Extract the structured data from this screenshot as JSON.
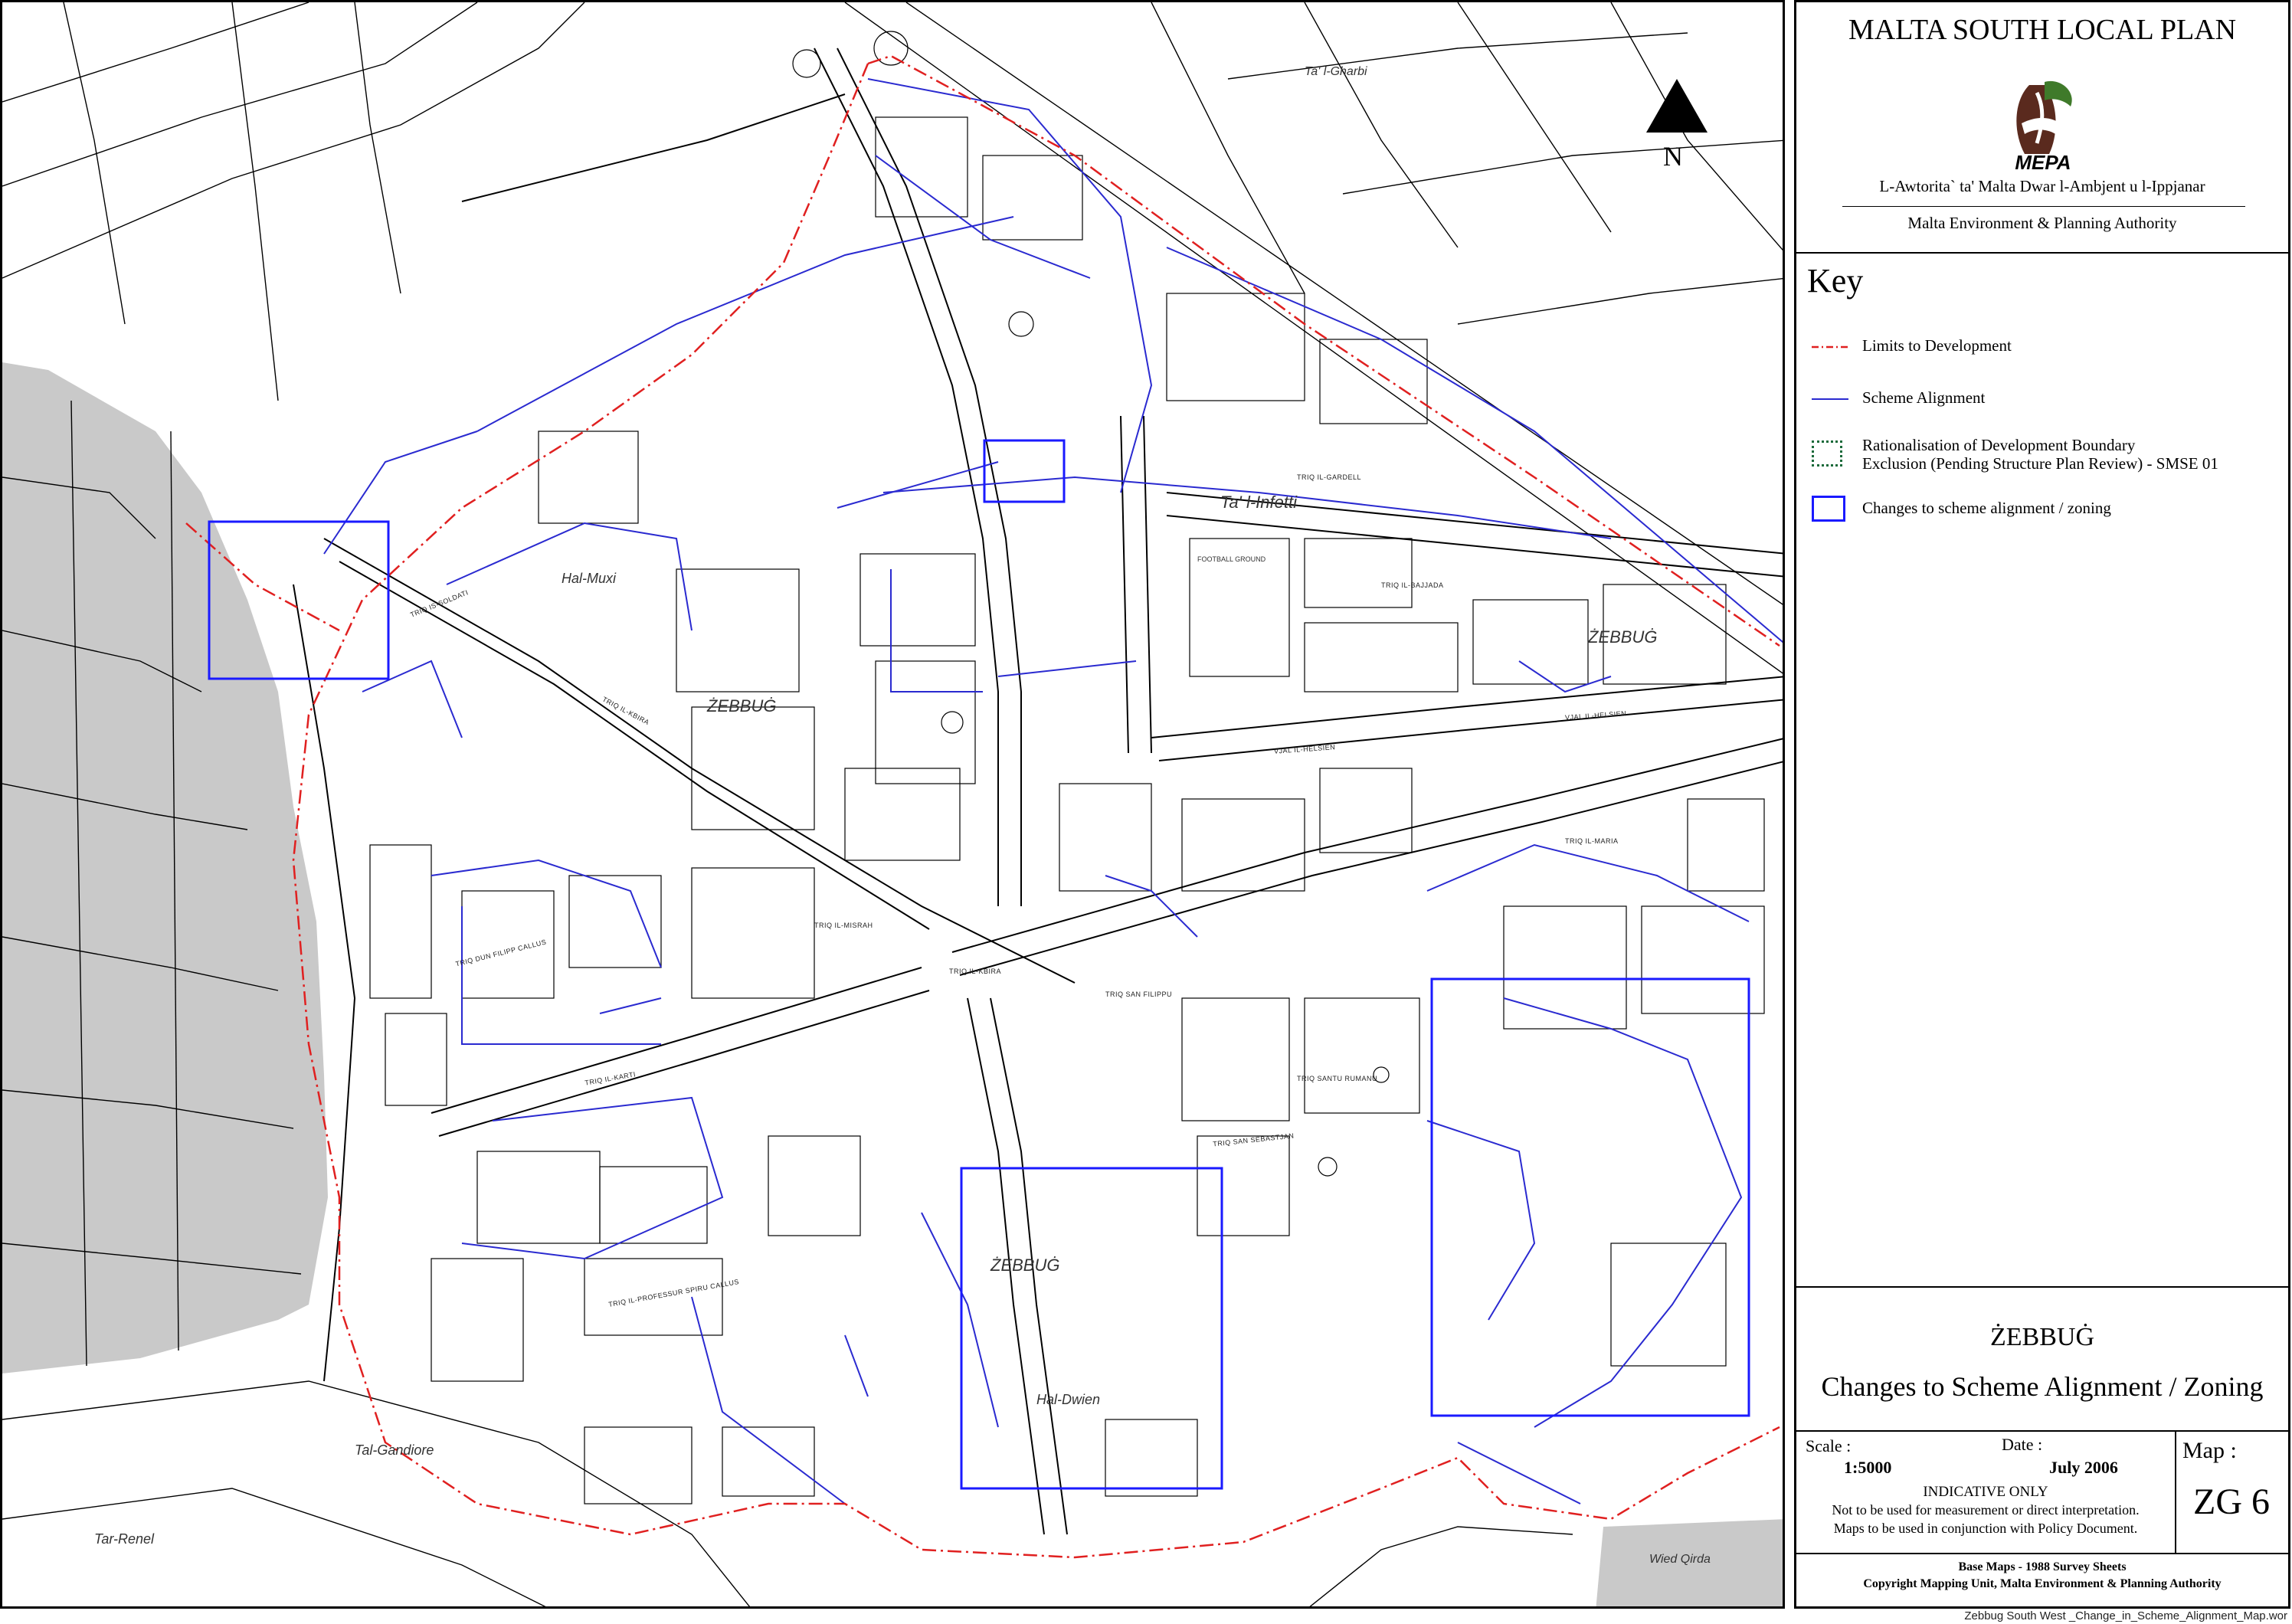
{
  "map": {
    "place_labels": [
      "Ta' l-Gharbi",
      "Ta' l-Infetti",
      "ŻEBBUĠ",
      "ŻEBBUĠ",
      "ŻEBBUĠ",
      "Hal-Muxi",
      "Hal-Dwien",
      "Tal-Gandiore",
      "Tar-Renel",
      "Wied Qirda",
      "FOOTBALL GROUND"
    ],
    "street_labels": [
      "TRIQ IL-KBIRA",
      "TRIQ IL-KBIRA",
      "VJAL IL-HELSIEN",
      "VJAL IL-HELSIEN",
      "TRIQ IL-MISRAH",
      "TRIQ IL-BAJJADA",
      "TRIQ SAN FILIPPU",
      "TRIQ IL-GARDELL",
      "TRIQ DUN FILIPP CALLUS",
      "TRIQ IS-SOLDATI",
      "TRIQ IL-PROFESSUR SPIRU CALLUS",
      "TRIQ SAN SEBASTJAN",
      "TRIQ IL-KARTI",
      "TRIQ IL-MARIA",
      "TRIQ SANTU RUMANU"
    ],
    "north_label": "N",
    "colors": {
      "limits": "#e02020",
      "scheme": "#2a2ad0",
      "changes": "#1a1aff",
      "rationalisation": "#1a6a3a",
      "grey_area": "#c9c9c9",
      "base": "#000000"
    }
  },
  "panel": {
    "title": "MALTA SOUTH LOCAL PLAN",
    "logo_text": "MEPA",
    "authority_mt": "L-Awtorita` ta' Malta Dwar l-Ambjent u l-Ippjanar",
    "authority_en": "Malta Environment & Planning Authority",
    "key_heading": "Key",
    "key_items": {
      "limits": "Limits to Development",
      "scheme": "Scheme Alignment",
      "rationalisation_1": "Rationalisation of Development Boundary",
      "rationalisation_2": "Exclusion (Pending Structure Plan Review) - SMSE 01",
      "changes": "Changes to scheme alignment / zoning"
    },
    "place": "ŻEBBUĠ",
    "map_title": "Changes to Scheme Alignment / Zoning",
    "scale_label": "Scale :",
    "scale_value": "1:5000",
    "date_label": "Date :",
    "date_value": "July 2006",
    "indicative": "INDICATIVE ONLY",
    "notice_1": "Not to be used for measurement or direct interpretation.",
    "notice_2": "Maps to be used in conjunction with Policy Document.",
    "map_label": "Map :",
    "map_number": "ZG 6",
    "base_maps": "Base Maps - 1988 Survey Sheets",
    "copyright": "Copyright Mapping Unit, Malta Environment & Planning Authority"
  },
  "footer": {
    "filename": "Zebbug South West _Change_in_Scheme_Alignment_Map.wor"
  }
}
